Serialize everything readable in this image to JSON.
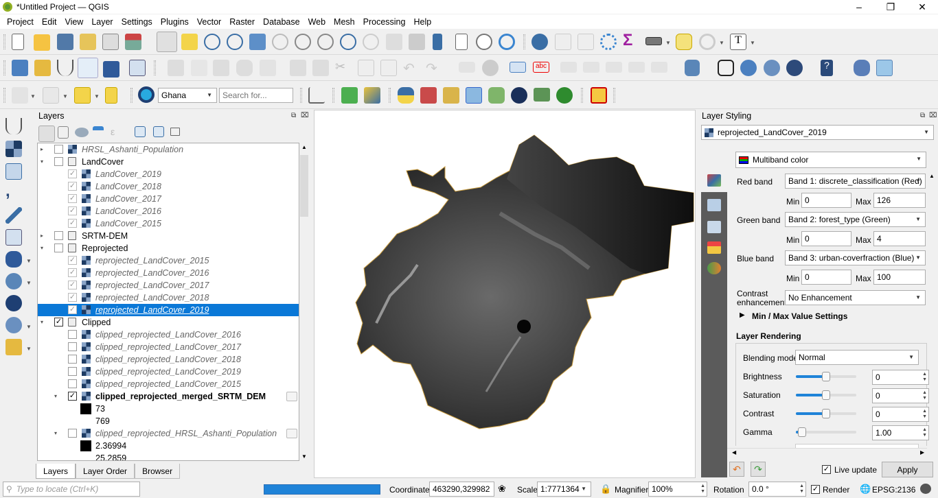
{
  "window": {
    "title": "*Untitled Project — QGIS",
    "controls": [
      "minimize",
      "restore",
      "close"
    ]
  },
  "menu": [
    "Project",
    "Edit",
    "View",
    "Layer",
    "Settings",
    "Plugins",
    "Vector",
    "Raster",
    "Database",
    "Web",
    "Mesh",
    "Processing",
    "Help"
  ],
  "toolbar3": {
    "geocoder_value": "Ghana",
    "search_placeholder": "Search for..."
  },
  "layers_panel": {
    "title": "Layers",
    "tabs": [
      "Layers",
      "Layer Order",
      "Browser"
    ],
    "active_tab": "Layers",
    "rows": [
      {
        "label": "HRSL_Ashanti_Population",
        "type": "raster",
        "checked": false,
        "expand": "collapsed",
        "style": "italic"
      },
      {
        "label": "LandCover",
        "type": "group",
        "checked": false,
        "expand": "expanded",
        "style": "normal"
      },
      {
        "label": "LandCover_2019",
        "type": "raster",
        "checked": true,
        "style": "italic"
      },
      {
        "label": "LandCover_2018",
        "type": "raster",
        "checked": true,
        "style": "italic"
      },
      {
        "label": "LandCover_2017",
        "type": "raster",
        "checked": true,
        "style": "italic"
      },
      {
        "label": "LandCover_2016",
        "type": "raster",
        "checked": true,
        "style": "italic"
      },
      {
        "label": "LandCover_2015",
        "type": "raster",
        "checked": true,
        "style": "italic"
      },
      {
        "label": "SRTM-DEM",
        "type": "group",
        "checked": false,
        "expand": "collapsed",
        "style": "normal"
      },
      {
        "label": "Reprojected",
        "type": "group",
        "checked": false,
        "expand": "expanded",
        "style": "normal"
      },
      {
        "label": "reprojected_LandCover_2015",
        "type": "raster",
        "checked": true,
        "style": "italic"
      },
      {
        "label": "reprojected_LandCover_2016",
        "type": "raster",
        "checked": true,
        "style": "italic"
      },
      {
        "label": "reprojected_LandCover_2017",
        "type": "raster",
        "checked": true,
        "style": "italic"
      },
      {
        "label": "reprojected_LandCover_2018",
        "type": "raster",
        "checked": true,
        "style": "italic"
      },
      {
        "label": "reprojected_LandCover_2019",
        "type": "raster",
        "checked": true,
        "style": "italic",
        "selected": true
      },
      {
        "label": "Clipped",
        "type": "group",
        "checked": true,
        "expand": "expanded",
        "style": "normal"
      },
      {
        "label": "clipped_reprojected_LandCover_2016",
        "type": "raster",
        "checked": false,
        "style": "italic"
      },
      {
        "label": "clipped_reprojected_LandCover_2017",
        "type": "raster",
        "checked": false,
        "style": "italic"
      },
      {
        "label": "clipped_reprojected_LandCover_2018",
        "type": "raster",
        "checked": false,
        "style": "italic"
      },
      {
        "label": "clipped_reprojected_LandCover_2019",
        "type": "raster",
        "checked": false,
        "style": "italic"
      },
      {
        "label": "clipped_reprojected_LandCover_2015",
        "type": "raster",
        "checked": false,
        "style": "italic"
      },
      {
        "label": "clipped_reprojected_merged_SRTM_DEM",
        "type": "raster",
        "checked": true,
        "expand": "expanded",
        "style": "bold",
        "memory": true
      },
      {
        "label": "73",
        "type": "legend",
        "swatch": "#000000"
      },
      {
        "label": "769",
        "type": "legend"
      },
      {
        "label": "clipped_reprojected_HRSL_Ashanti_Population",
        "type": "raster",
        "checked": false,
        "expand": "expanded",
        "style": "italic",
        "memory": true
      },
      {
        "label": "2.36994",
        "type": "legend",
        "swatch": "#000000"
      },
      {
        "label": "25.2859",
        "type": "legend"
      }
    ]
  },
  "styling_panel": {
    "title": "Layer Styling",
    "layer": "reprojected_LandCover_2019",
    "renderer": "Multiband color",
    "red": {
      "label": "Red band",
      "band": "Band 1: discrete_classification (Red)",
      "min": "0",
      "max": "126"
    },
    "green": {
      "label": "Green band",
      "band": "Band 2: forest_type (Green)",
      "min": "0",
      "max": "4"
    },
    "blue": {
      "label": "Blue band",
      "band": "Band 3: urban-coverfraction (Blue)",
      "min": "0",
      "max": "100"
    },
    "min_label": "Min",
    "max_label": "Max",
    "contrast_label_1": "Contrast",
    "contrast_label_2": "enhancement",
    "contrast_value": "No Enhancement",
    "minmax_section": "Min / Max Value Settings",
    "rendering_section": "Layer Rendering",
    "blending_label": "Blending mode",
    "blending_value": "Normal",
    "brightness": {
      "label": "Brightness",
      "value": "0",
      "slider_fraction": 0.5
    },
    "saturation": {
      "label": "Saturation",
      "value": "0",
      "slider_fraction": 0.5
    },
    "contrast": {
      "label": "Contrast",
      "value": "0",
      "slider_fraction": 0.5
    },
    "gamma": {
      "label": "Gamma",
      "value": "1.00",
      "slider_fraction": 0.1
    },
    "live_update_label": "Live update",
    "live_update_checked": true,
    "apply_label": "Apply"
  },
  "statusbar": {
    "locator_placeholder": "Type to locate (Ctrl+K)",
    "progress": 1.0,
    "coordinate_label": "Coordinate",
    "coordinate_value": "463290,329982",
    "scale_label": "Scale",
    "scale_value": "1:7771364",
    "magnifier_label": "Magnifier",
    "magnifier_value": "100%",
    "rotation_label": "Rotation",
    "rotation_value": "0.0 °",
    "render_label": "Render",
    "render_checked": true,
    "crs": "EPSG:2136"
  },
  "colors": {
    "selection": "#0a78d7",
    "progress": "#1f83d8",
    "sidebar": "#5b5b5b"
  }
}
